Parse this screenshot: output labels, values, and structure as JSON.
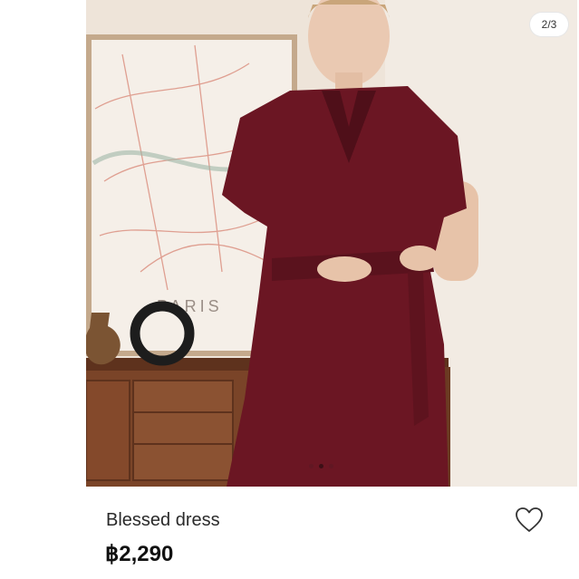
{
  "gallery": {
    "counter": "2/3",
    "poster_text": "PARIS",
    "dots_count": 3,
    "active_dot": 1
  },
  "product": {
    "name": "Blessed dress",
    "price": "฿2,290"
  },
  "icons": {
    "favorite": "heart-outline-icon"
  },
  "colors": {
    "dress": "#6b1623",
    "price": "#111111"
  }
}
